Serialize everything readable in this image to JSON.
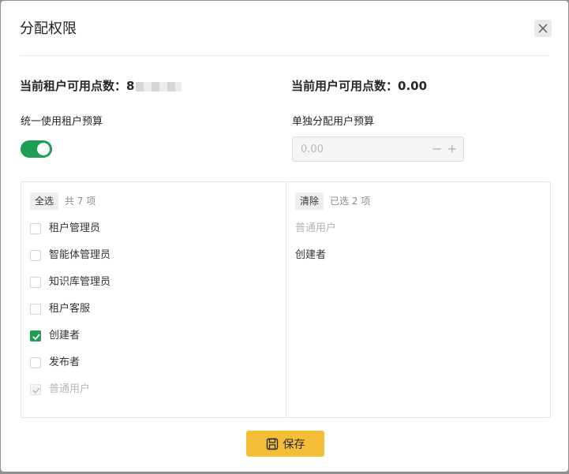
{
  "dialog": {
    "title": "分配权限",
    "close_icon": "close-icon"
  },
  "stats": {
    "tenant_available_label": "当前租户可用点数：",
    "tenant_available_value": "8",
    "user_available_label": "当前用户可用点数：",
    "user_available_value": "0.00"
  },
  "budget": {
    "unified_label": "统一使用租户预算",
    "unified_enabled": true,
    "individual_label": "单独分配用户预算",
    "individual_value": "0.00",
    "minus_symbol": "−",
    "plus_symbol": "+"
  },
  "transfer": {
    "left": {
      "select_all_label": "全选",
      "count_text": "共 7 项",
      "options": [
        {
          "label": "租户管理员",
          "checked": false,
          "disabled": false
        },
        {
          "label": "智能体管理员",
          "checked": false,
          "disabled": false
        },
        {
          "label": "知识库管理员",
          "checked": false,
          "disabled": false
        },
        {
          "label": "租户客服",
          "checked": false,
          "disabled": false
        },
        {
          "label": "创建者",
          "checked": true,
          "disabled": false
        },
        {
          "label": "发布者",
          "checked": false,
          "disabled": false
        },
        {
          "label": "普通用户",
          "checked": true,
          "disabled": true
        }
      ]
    },
    "right": {
      "clear_label": "清除",
      "count_text": "已选 2 项",
      "selected": [
        {
          "label": "普通用户",
          "disabled": true
        },
        {
          "label": "创建者",
          "disabled": false
        }
      ]
    }
  },
  "footer": {
    "save_label": "保存",
    "save_icon": "save-icon"
  },
  "colors": {
    "accent_green": "#1e9e55",
    "save_yellow": "#f3bd38"
  }
}
